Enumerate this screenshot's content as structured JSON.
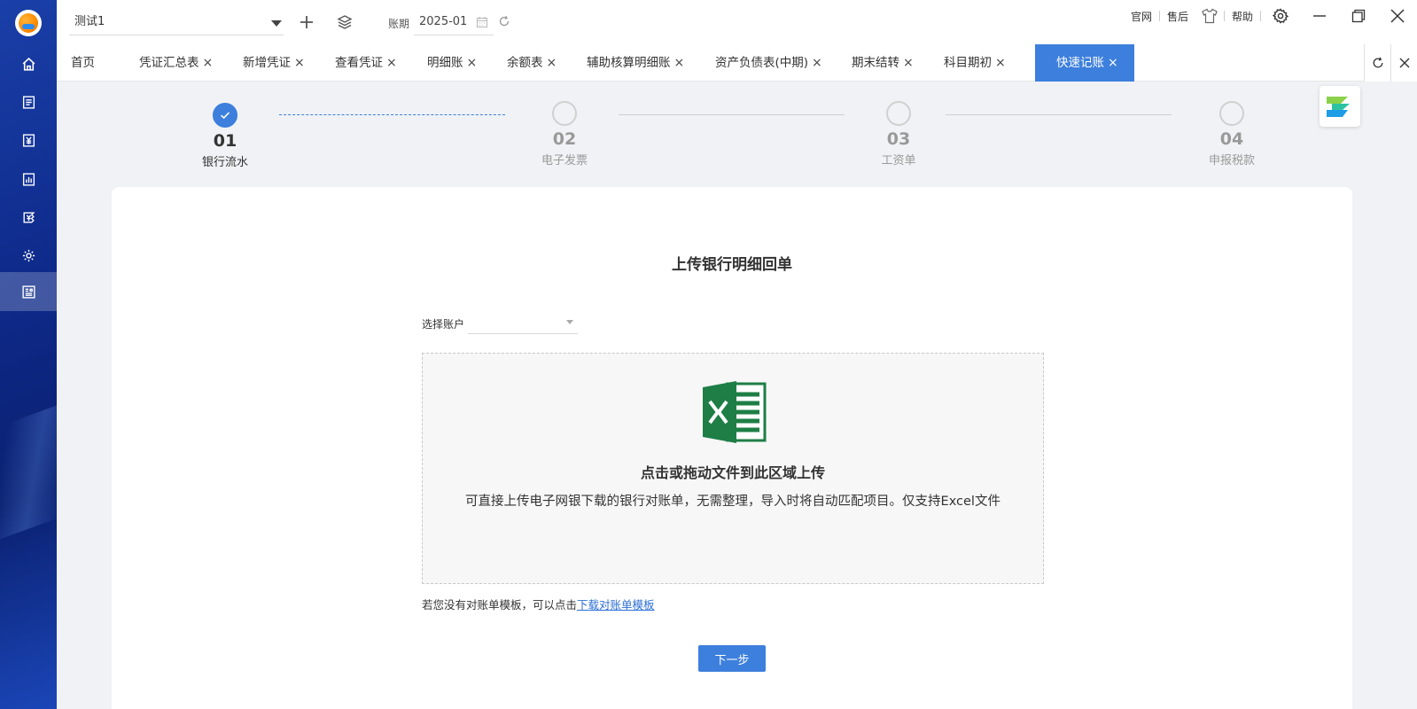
{
  "header": {
    "company": "测试1",
    "period_label": "账期",
    "period_value": "2025-01",
    "links": [
      "官网",
      "售后",
      "帮助"
    ]
  },
  "tabs": [
    {
      "label": "首页",
      "closable": false
    },
    {
      "label": "凭证汇总表",
      "closable": true
    },
    {
      "label": "新增凭证",
      "closable": true
    },
    {
      "label": "查看凭证",
      "closable": true
    },
    {
      "label": "明细账",
      "closable": true
    },
    {
      "label": "余额表",
      "closable": true
    },
    {
      "label": "辅助核算明细账",
      "closable": true
    },
    {
      "label": "资产负债表(中期)",
      "closable": true
    },
    {
      "label": "期末结转",
      "closable": true
    },
    {
      "label": "科目期初",
      "closable": true
    },
    {
      "label": "快速记账",
      "closable": true,
      "active": true
    }
  ],
  "close_glyph": "×",
  "steps": [
    {
      "num": "01",
      "name": "银行流水",
      "done": true
    },
    {
      "num": "02",
      "name": "电子发票",
      "done": false
    },
    {
      "num": "03",
      "name": "工资单",
      "done": false
    },
    {
      "num": "04",
      "name": "申报税款",
      "done": false
    }
  ],
  "main": {
    "title": "上传银行明细回单",
    "account_label": "选择账户",
    "account_value": "",
    "dropzone_title": "点击或拖动文件到此区域上传",
    "dropzone_desc": "可直接上传电子网银下载的银行对账单，无需整理，导入时将自动匹配项目。仅支持Excel文件",
    "template_note": "若您没有对账单模板，可以点击",
    "template_link": "下载对账单模板",
    "next_button": "下一步"
  },
  "colors": {
    "accent": "#3d7fdc",
    "sidebar": "#0e2a8a",
    "excel_green": "#1e7e45"
  },
  "sidebar": {
    "items": [
      "home-icon",
      "voucher-icon",
      "yen-icon",
      "report-icon",
      "tax-icon",
      "settings-icon",
      "quick-book-icon"
    ],
    "active_index": 6
  }
}
